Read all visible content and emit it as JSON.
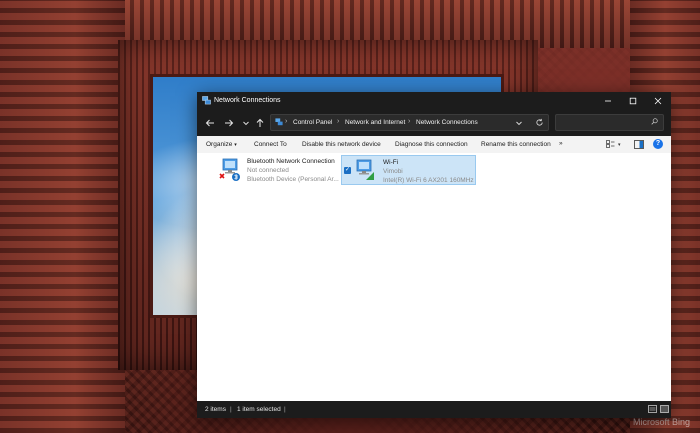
{
  "window": {
    "title": "Network Connections",
    "caption_buttons": [
      "minimize",
      "maximize",
      "close"
    ]
  },
  "navigation": {
    "breadcrumbs": [
      "Control Panel",
      "Network and Internet",
      "Network Connections"
    ],
    "search_placeholder": ""
  },
  "command_bar": {
    "organize": "Organize",
    "connect_to": "Connect To",
    "disable": "Disable this network device",
    "diagnose": "Diagnose this connection",
    "rename": "Rename this connection",
    "more": "»"
  },
  "connections": [
    {
      "name": "Bluetooth Network Connection",
      "status": "Not connected",
      "device": "Bluetooth Device (Personal Ar...",
      "selected": false
    },
    {
      "name": "Wi-Fi",
      "status": "Vimobi",
      "device": "Intel(R) Wi-Fi 6 AX201 160MHz",
      "selected": true
    }
  ],
  "status_bar": {
    "item_count": "2 items",
    "selection": "1 item selected"
  },
  "watermark": "Microsoft Bing",
  "colors": {
    "accent": "#1a73e8",
    "selection_bg": "#cce4f7",
    "titlebar_bg": "#1c1c1c"
  }
}
